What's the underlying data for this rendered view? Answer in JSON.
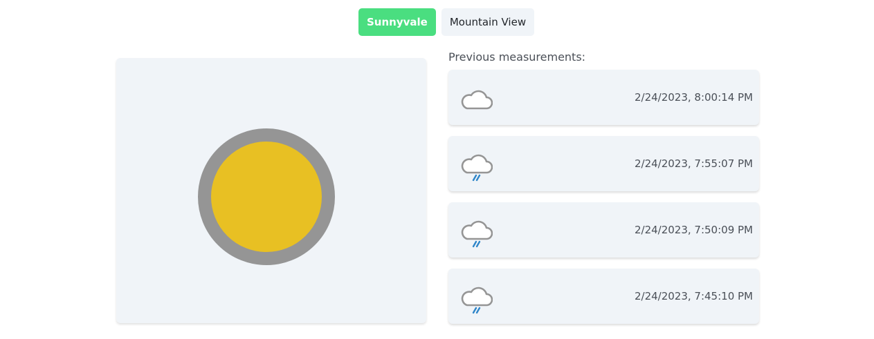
{
  "tabs": [
    {
      "label": "Sunnyvale",
      "active": true
    },
    {
      "label": "Mountain View",
      "active": false
    }
  ],
  "current": {
    "icon": "sun-icon"
  },
  "history": {
    "title": "Previous measurements:",
    "items": [
      {
        "icon": "cloud-icon",
        "time": "2/24/2023, 8:00:14 PM"
      },
      {
        "icon": "rain-cloud-icon",
        "time": "2/24/2023, 7:55:07 PM"
      },
      {
        "icon": "rain-cloud-icon",
        "time": "2/24/2023, 7:50:09 PM"
      },
      {
        "icon": "rain-cloud-icon",
        "time": "2/24/2023, 7:45:10 PM"
      }
    ]
  },
  "colors": {
    "accent": "#4ade80",
    "panel": "#f0f4f8",
    "sun": "#e8c023",
    "sun_ring": "#959595",
    "rain": "#2f86c9"
  }
}
